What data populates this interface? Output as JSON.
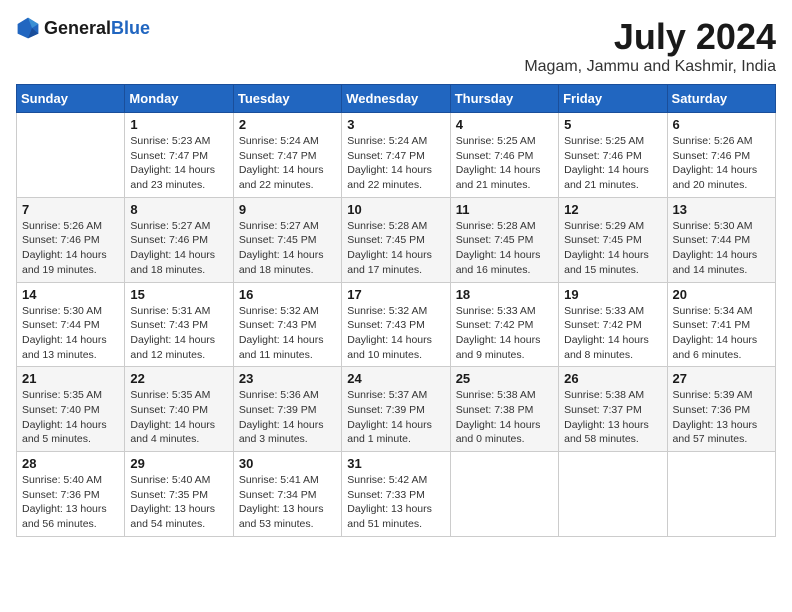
{
  "header": {
    "logo_general": "General",
    "logo_blue": "Blue",
    "month": "July 2024",
    "location": "Magam, Jammu and Kashmir, India"
  },
  "weekdays": [
    "Sunday",
    "Monday",
    "Tuesday",
    "Wednesday",
    "Thursday",
    "Friday",
    "Saturday"
  ],
  "weeks": [
    [
      {
        "day": "",
        "info": ""
      },
      {
        "day": "1",
        "info": "Sunrise: 5:23 AM\nSunset: 7:47 PM\nDaylight: 14 hours\nand 23 minutes."
      },
      {
        "day": "2",
        "info": "Sunrise: 5:24 AM\nSunset: 7:47 PM\nDaylight: 14 hours\nand 22 minutes."
      },
      {
        "day": "3",
        "info": "Sunrise: 5:24 AM\nSunset: 7:47 PM\nDaylight: 14 hours\nand 22 minutes."
      },
      {
        "day": "4",
        "info": "Sunrise: 5:25 AM\nSunset: 7:46 PM\nDaylight: 14 hours\nand 21 minutes."
      },
      {
        "day": "5",
        "info": "Sunrise: 5:25 AM\nSunset: 7:46 PM\nDaylight: 14 hours\nand 21 minutes."
      },
      {
        "day": "6",
        "info": "Sunrise: 5:26 AM\nSunset: 7:46 PM\nDaylight: 14 hours\nand 20 minutes."
      }
    ],
    [
      {
        "day": "7",
        "info": "Sunrise: 5:26 AM\nSunset: 7:46 PM\nDaylight: 14 hours\nand 19 minutes."
      },
      {
        "day": "8",
        "info": "Sunrise: 5:27 AM\nSunset: 7:46 PM\nDaylight: 14 hours\nand 18 minutes."
      },
      {
        "day": "9",
        "info": "Sunrise: 5:27 AM\nSunset: 7:45 PM\nDaylight: 14 hours\nand 18 minutes."
      },
      {
        "day": "10",
        "info": "Sunrise: 5:28 AM\nSunset: 7:45 PM\nDaylight: 14 hours\nand 17 minutes."
      },
      {
        "day": "11",
        "info": "Sunrise: 5:28 AM\nSunset: 7:45 PM\nDaylight: 14 hours\nand 16 minutes."
      },
      {
        "day": "12",
        "info": "Sunrise: 5:29 AM\nSunset: 7:45 PM\nDaylight: 14 hours\nand 15 minutes."
      },
      {
        "day": "13",
        "info": "Sunrise: 5:30 AM\nSunset: 7:44 PM\nDaylight: 14 hours\nand 14 minutes."
      }
    ],
    [
      {
        "day": "14",
        "info": "Sunrise: 5:30 AM\nSunset: 7:44 PM\nDaylight: 14 hours\nand 13 minutes."
      },
      {
        "day": "15",
        "info": "Sunrise: 5:31 AM\nSunset: 7:43 PM\nDaylight: 14 hours\nand 12 minutes."
      },
      {
        "day": "16",
        "info": "Sunrise: 5:32 AM\nSunset: 7:43 PM\nDaylight: 14 hours\nand 11 minutes."
      },
      {
        "day": "17",
        "info": "Sunrise: 5:32 AM\nSunset: 7:43 PM\nDaylight: 14 hours\nand 10 minutes."
      },
      {
        "day": "18",
        "info": "Sunrise: 5:33 AM\nSunset: 7:42 PM\nDaylight: 14 hours\nand 9 minutes."
      },
      {
        "day": "19",
        "info": "Sunrise: 5:33 AM\nSunset: 7:42 PM\nDaylight: 14 hours\nand 8 minutes."
      },
      {
        "day": "20",
        "info": "Sunrise: 5:34 AM\nSunset: 7:41 PM\nDaylight: 14 hours\nand 6 minutes."
      }
    ],
    [
      {
        "day": "21",
        "info": "Sunrise: 5:35 AM\nSunset: 7:40 PM\nDaylight: 14 hours\nand 5 minutes."
      },
      {
        "day": "22",
        "info": "Sunrise: 5:35 AM\nSunset: 7:40 PM\nDaylight: 14 hours\nand 4 minutes."
      },
      {
        "day": "23",
        "info": "Sunrise: 5:36 AM\nSunset: 7:39 PM\nDaylight: 14 hours\nand 3 minutes."
      },
      {
        "day": "24",
        "info": "Sunrise: 5:37 AM\nSunset: 7:39 PM\nDaylight: 14 hours\nand 1 minute."
      },
      {
        "day": "25",
        "info": "Sunrise: 5:38 AM\nSunset: 7:38 PM\nDaylight: 14 hours\nand 0 minutes."
      },
      {
        "day": "26",
        "info": "Sunrise: 5:38 AM\nSunset: 7:37 PM\nDaylight: 13 hours\nand 58 minutes."
      },
      {
        "day": "27",
        "info": "Sunrise: 5:39 AM\nSunset: 7:36 PM\nDaylight: 13 hours\nand 57 minutes."
      }
    ],
    [
      {
        "day": "28",
        "info": "Sunrise: 5:40 AM\nSunset: 7:36 PM\nDaylight: 13 hours\nand 56 minutes."
      },
      {
        "day": "29",
        "info": "Sunrise: 5:40 AM\nSunset: 7:35 PM\nDaylight: 13 hours\nand 54 minutes."
      },
      {
        "day": "30",
        "info": "Sunrise: 5:41 AM\nSunset: 7:34 PM\nDaylight: 13 hours\nand 53 minutes."
      },
      {
        "day": "31",
        "info": "Sunrise: 5:42 AM\nSunset: 7:33 PM\nDaylight: 13 hours\nand 51 minutes."
      },
      {
        "day": "",
        "info": ""
      },
      {
        "day": "",
        "info": ""
      },
      {
        "day": "",
        "info": ""
      }
    ]
  ]
}
